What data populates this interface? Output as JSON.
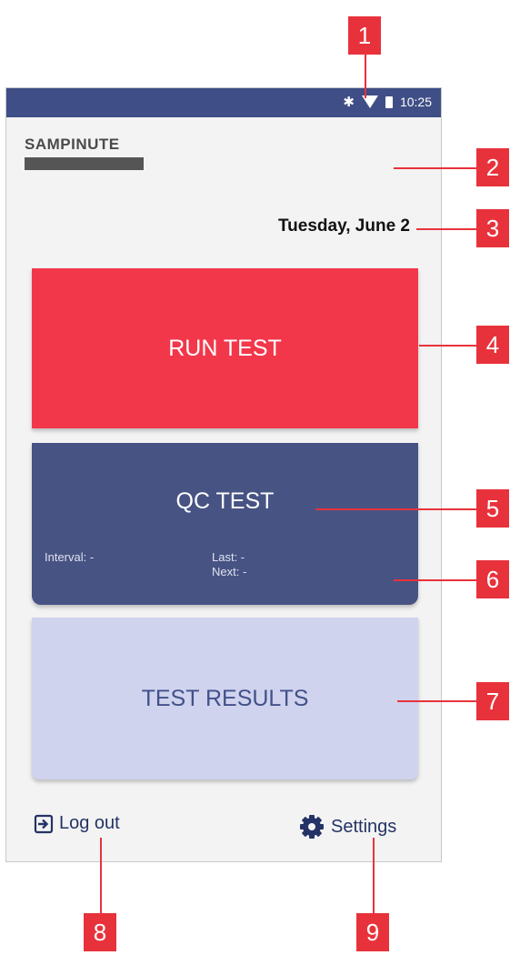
{
  "status_bar": {
    "time": "10:25"
  },
  "header": {
    "logo_text": "SAMPINUTE",
    "date": "Tuesday, June 2"
  },
  "cards": {
    "run_test": "RUN TEST",
    "qc_test": "QC TEST",
    "interval": "Interval: -",
    "last": "Last: -",
    "next": "Next: -",
    "test_results": "TEST RESULTS"
  },
  "footer": {
    "logout": "Log out",
    "settings": "Settings"
  },
  "callouts": [
    "1",
    "2",
    "3",
    "4",
    "5",
    "6",
    "7",
    "8",
    "9"
  ],
  "colors": {
    "status_bar": "#3f4e86",
    "run_test": "#f2374b",
    "qc_test": "#475383",
    "test_results": "#cfd3ee",
    "callout": "#e8323b"
  }
}
